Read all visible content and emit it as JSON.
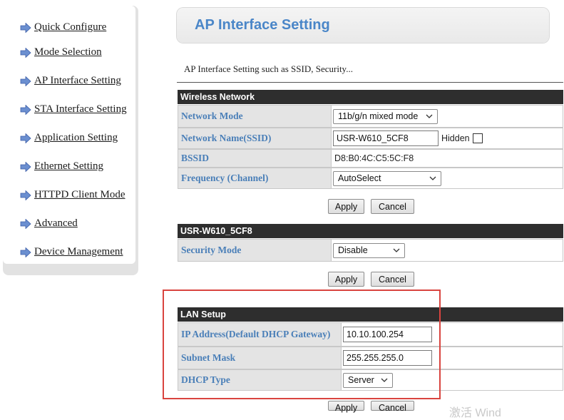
{
  "sidebar": {
    "items": [
      {
        "label": "Quick Configure"
      },
      {
        "label": "Mode Selection"
      },
      {
        "label": "AP Interface Setting"
      },
      {
        "label": "STA Interface Setting"
      },
      {
        "label": "Application Setting"
      },
      {
        "label": "Ethernet Setting"
      },
      {
        "label": "HTTPD Client Mode"
      },
      {
        "label": "Advanced"
      },
      {
        "label": "Device Management"
      }
    ]
  },
  "header": {
    "title": "AP Interface Setting",
    "subtitle": "AP Interface Setting such as SSID, Security..."
  },
  "wireless": {
    "heading": "Wireless Network",
    "network_mode_label": "Network Mode",
    "network_mode_value": "11b/g/n mixed mode",
    "ssid_label": "Network Name(SSID)",
    "ssid_value": "USR-W610_5CF8",
    "hidden_label": "Hidden",
    "bssid_label": "BSSID",
    "bssid_value": "D8:B0:4C:C5:5C:F8",
    "frequency_label": "Frequency (Channel)",
    "frequency_value": "AutoSelect"
  },
  "security": {
    "heading": "USR-W610_5CF8",
    "mode_label": "Security Mode",
    "mode_value": "Disable"
  },
  "lan": {
    "heading": "LAN Setup",
    "ip_label": "IP Address(Default DHCP Gateway)",
    "ip_value": "10.10.100.254",
    "subnet_label": "Subnet Mask",
    "subnet_value": "255.255.255.0",
    "dhcp_label": "DHCP Type",
    "dhcp_value": "Server"
  },
  "buttons": {
    "apply": "Apply",
    "cancel": "Cancel"
  },
  "watermark": "激活 Wind",
  "colors": {
    "accent_blue": "#4a86c8",
    "label_blue": "#4a7fb8",
    "section_header": "#2e2e2e",
    "highlight_red": "#d9443f"
  }
}
